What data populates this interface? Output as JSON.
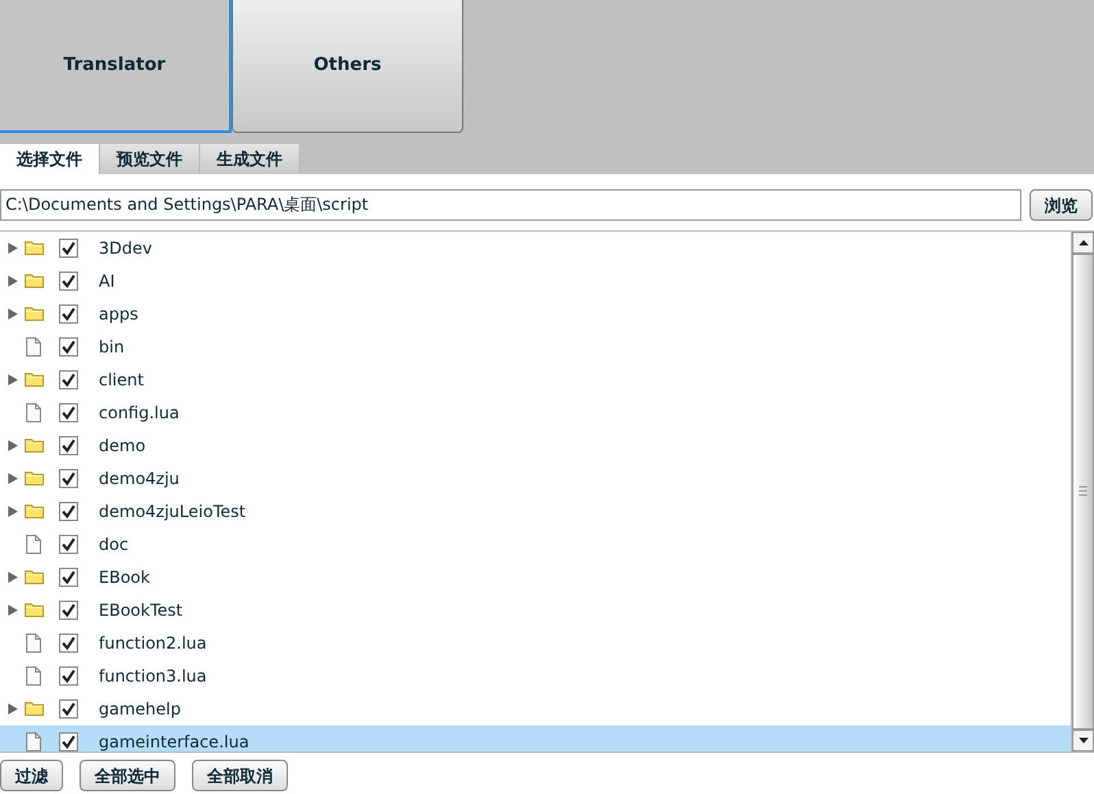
{
  "modes": [
    {
      "label": "Translator",
      "selected": true
    },
    {
      "label": "Others",
      "selected": false
    }
  ],
  "tabs": [
    {
      "label": "选择文件",
      "selected": true
    },
    {
      "label": "预览文件",
      "selected": false
    },
    {
      "label": "生成文件",
      "selected": false
    }
  ],
  "path": {
    "value": "C:\\Documents and Settings\\PARA\\桌面\\script"
  },
  "browse_button": "浏览",
  "files": [
    {
      "kind": "folder",
      "name": "3Ddev",
      "checked": true,
      "selected": false
    },
    {
      "kind": "folder",
      "name": "AI",
      "checked": true,
      "selected": false
    },
    {
      "kind": "folder",
      "name": "apps",
      "checked": true,
      "selected": false
    },
    {
      "kind": "file",
      "name": "bin",
      "checked": true,
      "selected": false
    },
    {
      "kind": "folder",
      "name": "client",
      "checked": true,
      "selected": false
    },
    {
      "kind": "file",
      "name": "config.lua",
      "checked": true,
      "selected": false
    },
    {
      "kind": "folder",
      "name": "demo",
      "checked": true,
      "selected": false
    },
    {
      "kind": "folder",
      "name": "demo4zju",
      "checked": true,
      "selected": false
    },
    {
      "kind": "folder",
      "name": "demo4zjuLeioTest",
      "checked": true,
      "selected": false
    },
    {
      "kind": "file",
      "name": "doc",
      "checked": true,
      "selected": false
    },
    {
      "kind": "folder",
      "name": "EBook",
      "checked": true,
      "selected": false
    },
    {
      "kind": "folder",
      "name": "EBookTest",
      "checked": true,
      "selected": false
    },
    {
      "kind": "file",
      "name": "function2.lua",
      "checked": true,
      "selected": false
    },
    {
      "kind": "file",
      "name": "function3.lua",
      "checked": true,
      "selected": false
    },
    {
      "kind": "folder",
      "name": "gamehelp",
      "checked": true,
      "selected": false
    },
    {
      "kind": "file",
      "name": "gameinterface.lua",
      "checked": true,
      "selected": true
    }
  ],
  "bottom_buttons": [
    "过滤",
    "全部选中",
    "全部取消"
  ]
}
